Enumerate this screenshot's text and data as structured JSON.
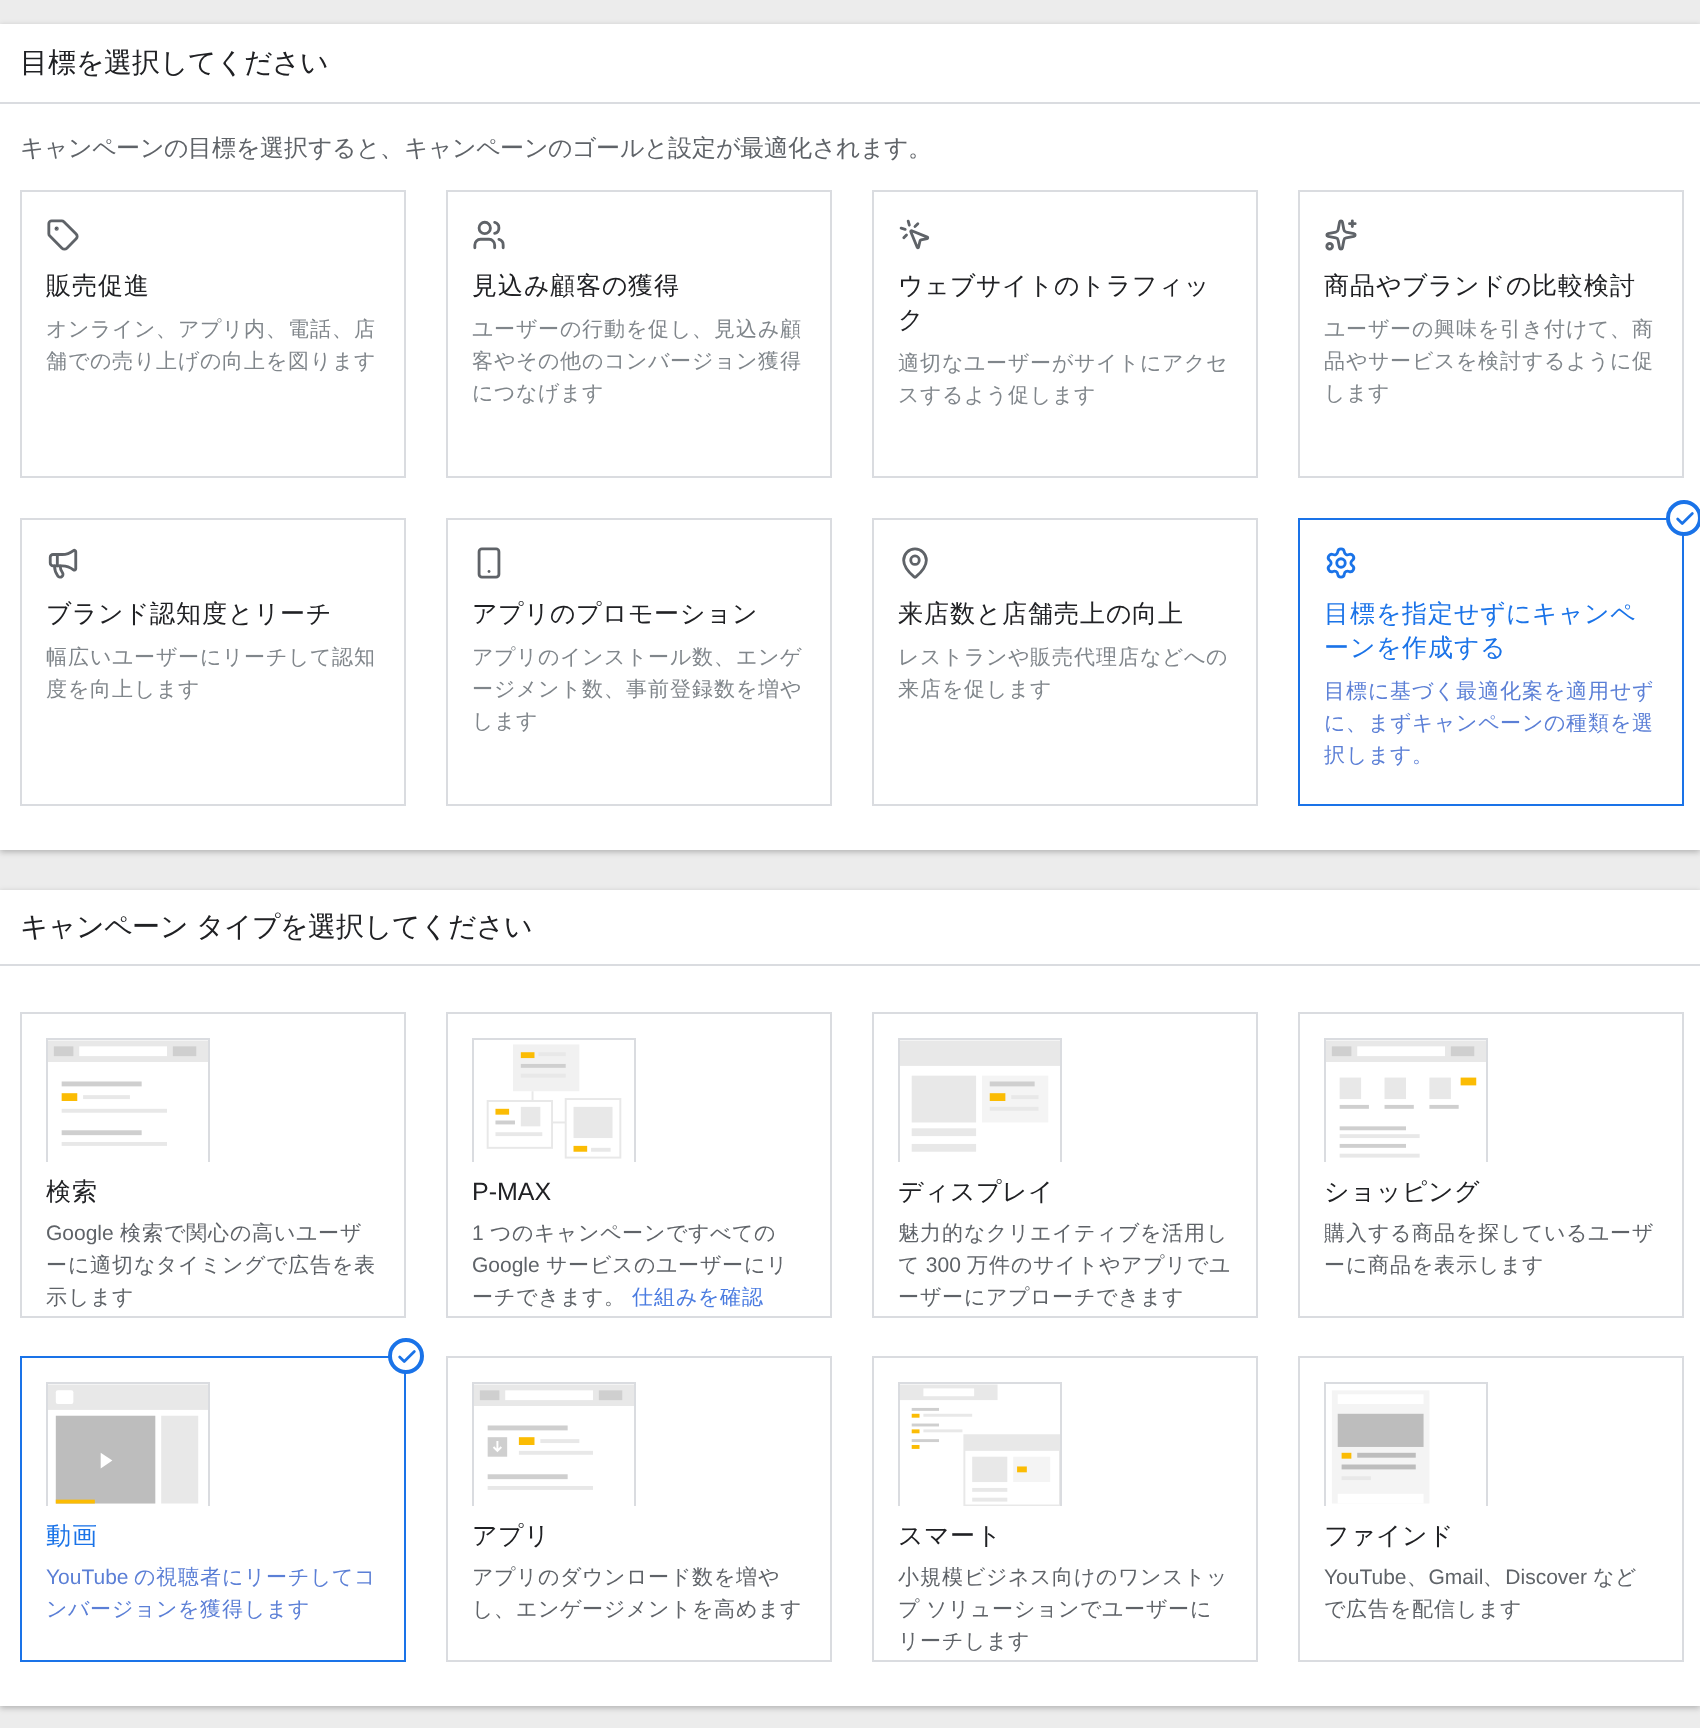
{
  "goal_section": {
    "title": "目標を選択してください",
    "subtitle": "キャンペーンの目標を選択すると、キャンペーンのゴールと設定が最適化されます。",
    "goals": [
      {
        "kind": "tag",
        "title": "販売促進",
        "description": "オンライン、アプリ内、電話、店舗での売り上げの向上を図ります",
        "selected": false
      },
      {
        "kind": "people",
        "title": "見込み顧客の獲得",
        "description": "ユーザーの行動を促し、見込み顧客やその他のコンバージョン獲得につなげます",
        "selected": false
      },
      {
        "kind": "cursor",
        "title": "ウェブサイトのトラフィック",
        "description": "適切なユーザーがサイトにアクセスするよう促します",
        "selected": false
      },
      {
        "kind": "sparkle",
        "title": "商品やブランドの比較検討",
        "description": "ユーザーの興味を引き付けて、商品やサービスを検討するように促します",
        "selected": false
      },
      {
        "kind": "megaphone",
        "title": "ブランド認知度とリーチ",
        "description": "幅広いユーザーにリーチして認知度を向上します",
        "selected": false
      },
      {
        "kind": "phone",
        "title": "アプリのプロモーション",
        "description": "アプリのインストール数、エンゲージメント数、事前登録数を増やします",
        "selected": false
      },
      {
        "kind": "pin",
        "title": "来店数と店舗売上の向上",
        "description": "レストランや販売代理店などへの来店を促します",
        "selected": false
      },
      {
        "kind": "gear",
        "title": "目標を指定せずにキャンペーンを作成する",
        "description": "目標に基づく最適化案を適用せずに、まずキャンペーンの種類を選択します。",
        "selected": true
      }
    ]
  },
  "type_section": {
    "title": "キャンペーン タイプを選択してください",
    "types": [
      {
        "kind": "search",
        "title": "検索",
        "description": "Google 検索で関心の高いユーザーに適切なタイミングで広告を表示します",
        "selected": false
      },
      {
        "kind": "pmax",
        "title": "P-MAX",
        "description": "1 つのキャンペーンですべての Google サービスのユーザーにリーチできます。",
        "link": "仕組みを確認",
        "selected": false
      },
      {
        "kind": "display",
        "title": "ディスプレイ",
        "description": "魅力的なクリエイティブを活用して 300 万件のサイトやアプリでユーザーにアプローチできます",
        "selected": false
      },
      {
        "kind": "shopping",
        "title": "ショッピング",
        "description": "購入する商品を探しているユーザーに商品を表示します",
        "selected": false
      },
      {
        "kind": "video",
        "title": "動画",
        "description": "YouTube の視聴者にリーチしてコンバージョンを獲得します",
        "selected": true
      },
      {
        "kind": "app",
        "title": "アプリ",
        "description": "アプリのダウンロード数を増やし、エンゲージメントを高めます",
        "selected": false
      },
      {
        "kind": "smart",
        "title": "スマート",
        "description": "小規模ビジネス向けのワンストップ ソリューションでユーザーにリーチします",
        "selected": false
      },
      {
        "kind": "discover",
        "title": "ファインド",
        "description": "YouTube、Gmail、Discover などで広告を配信します",
        "selected": false
      }
    ]
  }
}
